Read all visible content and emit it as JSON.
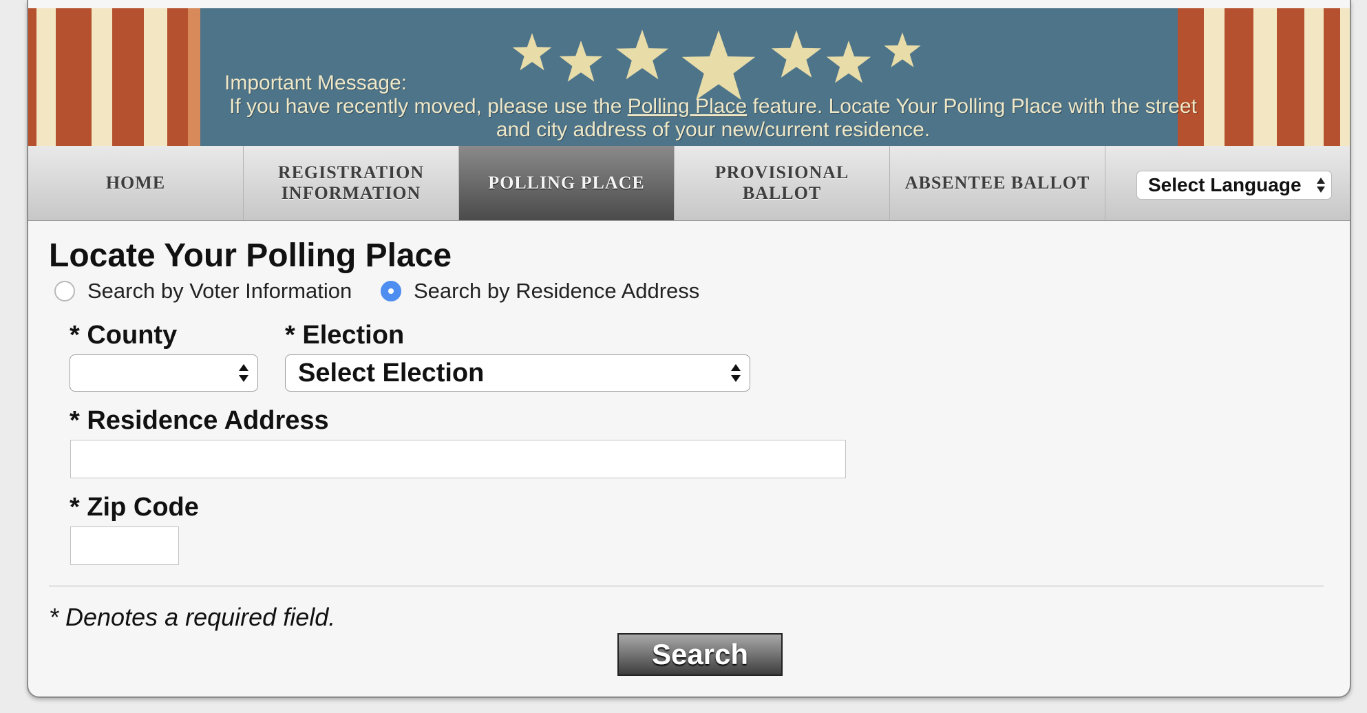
{
  "banner": {
    "message_title": "Important Message:",
    "message_before_link": "If you have recently moved, please use the ",
    "message_link": "Polling Place",
    "message_after_link": " feature. Locate Your Polling Place with the street and city address of your new/current residence."
  },
  "nav": {
    "tabs": [
      {
        "label": "HOME"
      },
      {
        "label": "REGISTRATION INFORMATION"
      },
      {
        "label": "POLLING PLACE",
        "active": true
      },
      {
        "label": "PROVISIONAL BALLOT"
      },
      {
        "label": "ABSENTEE BALLOT"
      }
    ],
    "language_select": "Select Language"
  },
  "form": {
    "title": "Locate Your Polling Place",
    "search_modes": [
      {
        "label": "Search by Voter Information",
        "checked": false
      },
      {
        "label": "Search by Residence Address",
        "checked": true
      }
    ],
    "county_label": "* County",
    "county_value": "",
    "election_label": "* Election",
    "election_value": "Select Election",
    "address_label": "* Residence Address",
    "address_value": "",
    "zip_label": "* Zip Code",
    "zip_value": "",
    "required_note": "* Denotes a required field.",
    "search_button": "Search"
  },
  "colors": {
    "banner_blue": "#4e7489",
    "stripe_red": "#b5512f",
    "stripe_cream": "#f2e7c2",
    "star_gold": "#e8dca8",
    "radio_selected": "#4d8ef0"
  }
}
